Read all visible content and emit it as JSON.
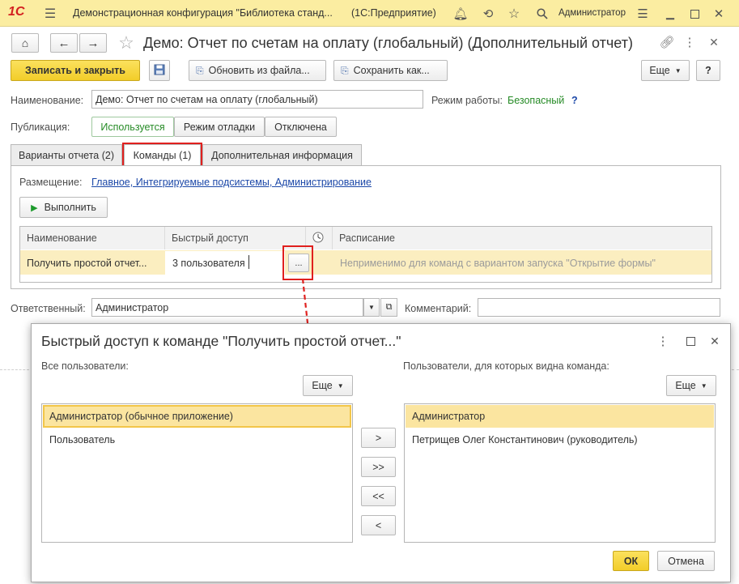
{
  "app": {
    "title": "Демонстрационная конфигурация \"Библиотека станд...",
    "platform": "(1С:Предприятие)",
    "user": "Администратор",
    "logo": "1С"
  },
  "form": {
    "title": "Демо: Отчет по счетам на оплату (глобальный) (Дополнительный отчет)",
    "toolbar": {
      "save_close": "Записать и закрыть",
      "update_from_file": "Обновить из файла...",
      "save_as": "Сохранить как...",
      "more": "Еще",
      "help": "?"
    },
    "name_label": "Наименование:",
    "name_value": "Демо: Отчет по счетам на оплату (глобальный)",
    "mode_label": "Режим работы:",
    "mode_value": "Безопасный",
    "mode_help": "?",
    "publication_label": "Публикация:",
    "publication_options": [
      "Используется",
      "Режим отладки",
      "Отключена"
    ],
    "tabs": [
      "Варианты отчета (2)",
      "Команды (1)",
      "Дополнительная информация"
    ],
    "placement_label": "Размещение:",
    "placement_value": "Главное, Интегрируемые подсистемы, Администрирование",
    "run_button": "Выполнить",
    "grid": {
      "columns": [
        "Наименование",
        "Быстрый доступ",
        "Расписание"
      ],
      "row": {
        "name": "Получить простой отчет...",
        "quick_access": "3 пользователя",
        "ellipsis": "...",
        "schedule": "Неприменимо для команд с вариантом запуска \"Открытие формы\""
      }
    },
    "responsible_label": "Ответственный:",
    "responsible_value": "Администратор",
    "comment_label": "Комментарий:",
    "comment_value": ""
  },
  "dialog": {
    "title": "Быстрый доступ к команде \"Получить простой отчет...\"",
    "all_users_label": "Все пользователи:",
    "visible_users_label": "Пользователи, для которых видна команда:",
    "more": "Еще",
    "all_users": [
      "Администратор (обычное приложение)",
      "Пользователь"
    ],
    "visible_users": [
      "Администратор",
      "Петрищев Олег Константинович (руководитель)"
    ],
    "move_buttons": [
      ">",
      ">>",
      "<<",
      "<"
    ],
    "ok": "ОК",
    "cancel": "Отмена"
  },
  "colors": {
    "accent_yellow": "#f7d73a",
    "topbar": "#fbeda1",
    "selection": "#fbe5a0",
    "highlight_red": "#e0201e",
    "link_blue": "#1c48a8",
    "green": "#268b26"
  }
}
